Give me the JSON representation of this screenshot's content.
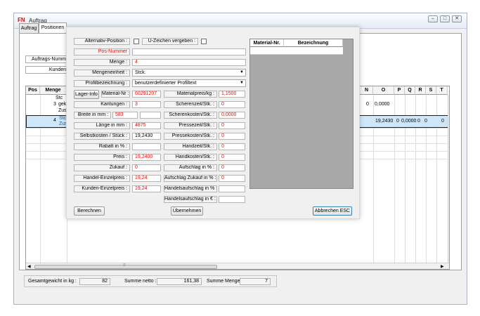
{
  "window": {
    "title": "Auftrag",
    "logo": "FN",
    "controls": [
      "–",
      "□",
      "✕"
    ]
  },
  "tabs": [
    "Auftrag",
    "Positionen"
  ],
  "background": {
    "fields": [
      "Auftrags-Numm",
      "Kunden"
    ],
    "grid": {
      "headers": [
        "Pos",
        "Menge",
        "N",
        "O",
        "P",
        "Q",
        "R",
        "S",
        "T"
      ],
      "row1": {
        "pos": "3",
        "lines": [
          "Stc",
          "gek",
          "Zus"
        ],
        "n": "0",
        "o": "0,0000"
      },
      "row2": {
        "pos": "4",
        "lines": [
          "Stc",
          "Zus"
        ],
        "o": "19,2430",
        "p": "0",
        "p2": "0,0000",
        "q": "0",
        "r": "0",
        "t": "0"
      },
      "hscroll_grip": "≡"
    },
    "summary": {
      "gesamtgewicht_label": "Gesamtgewicht in kg :",
      "gesamtgewicht": "82",
      "summe_netto_label": "Summe netto :",
      "summe_netto": "161,38",
      "summe_menge_label": "Summe Menge :",
      "summe_menge": "7"
    }
  },
  "dialog": {
    "alternativ_label": "Alternativ-Position :",
    "zeichen_label": "Ü-Zeichen vergeben :",
    "posnummer_label": "Pos-Nummer",
    "menge_label": "Menge :",
    "menge": "4",
    "mengeneinheit_label": "Mengeneinheit :",
    "mengeneinheit": "Stck.",
    "profil_label": "Profilbezeichnung :",
    "profil": "benutzerdefinierter Profiltext",
    "lagerinfo_button": "Lager-Info",
    "material_label": "Material-Nr :",
    "material": "60291207",
    "kantungen_label": "Kantungen :",
    "kantungen": "3",
    "breite_label": "Breite in mm :",
    "breite": "583",
    "laenge_label": "Länge in mm :",
    "laenge": "4875",
    "selbstkosten_label": "Selbstkosten / Stück :",
    "selbstkosten": "19,2430",
    "rabatt_label": "Rabatt in % :",
    "rabatt": "",
    "preis_label": "Preis :",
    "preis": "19,2400",
    "zukauf_label": "Zukauf :",
    "zukauf": "0",
    "handel_einzel_label": "Handel-Einzelpreis :",
    "handel_einzel": "19,24",
    "kunden_einzel_label": "Kunden-Einzelpreis :",
    "kunden_einzel": "19,24",
    "materialpreis_label": "Materialpreis/kg :",
    "materialpreis": "1,1500",
    "scherenzeit_label": "Scherenzeit/Stk. :",
    "scherenzeit": "0",
    "scherenkosten_label": "Scherenkosten/Stk. :",
    "scherenkosten": "0,0000",
    "pressezeit_label": "Pressezeit/Stk. :",
    "pressezeit": "0",
    "pressekosten_label": "Pressekosten/Stk. :",
    "pressekosten": "0",
    "handzeit_label": "Handzeit/Stk. :",
    "handzeit": "0",
    "handkosten_label": "Handkosten/Stk. :",
    "handkosten": "0",
    "aufschlag_label": "Aufschlag in % :",
    "aufschlag": "0",
    "aufschlag_zukauf_label": "Aufschlag Zukauf in % :",
    "aufschlag_zukauf": "0",
    "handelsaufschlag_pct_label": "Handelsaufschlag in % :",
    "handelsaufschlag_pct": "",
    "handelsaufschlag_eur_label": "Handelsaufschlag in € :",
    "handelsaufschlag_eur": "",
    "material_grid_headers": [
      "Material-Nr.",
      "Bezeichnung"
    ],
    "buttons": {
      "berechnen": "Berechnen",
      "uebernehmen": "Übernehmen",
      "abbrechen": "Abbrechen ESC"
    }
  }
}
